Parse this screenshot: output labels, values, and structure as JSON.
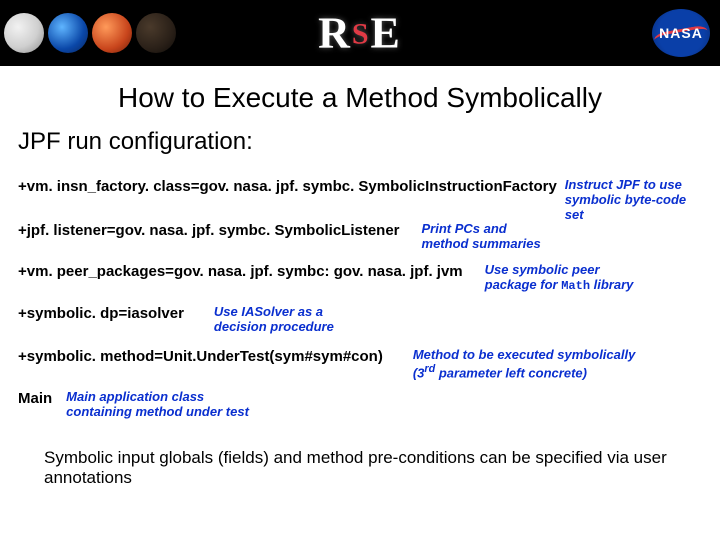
{
  "header": {
    "logo_r": "R",
    "logo_s": "S",
    "logo_e": "E",
    "nasa": "NASA"
  },
  "title": "How to Execute a Method Symbolically",
  "subtitle": "JPF run configuration:",
  "lines": {
    "l1": {
      "cfg": "+vm. insn_factory. class=gov. nasa. jpf. symbc. SymbolicInstructionFactory",
      "note1": "Instruct JPF to use",
      "note2": "symbolic byte-code set"
    },
    "l2": {
      "cfg": "+jpf. listener=gov. nasa. jpf. symbc. SymbolicListener",
      "note1": "Print PCs and",
      "note2": "method summaries"
    },
    "l3": {
      "cfg": "+vm. peer_packages=gov. nasa. jpf. symbc: gov. nasa. jpf. jvm",
      "note1": "Use symbolic peer",
      "note2a": "package for ",
      "note2mono": "Math",
      "note2b": " library"
    },
    "l4": {
      "cfg": "+symbolic. dp=iasolver",
      "note1": "Use IASolver as a",
      "note2": "decision procedure"
    },
    "l5": {
      "cfg": "+symbolic. method=Unit.UnderTest(sym#sym#con)",
      "note1": "Method to be executed symbolically",
      "note2a": "(3",
      "note2sup": "rd",
      "note2b": " parameter left concrete)"
    },
    "l6": {
      "kw": "Main",
      "note1": "Main application class",
      "note2": "containing method under test"
    }
  },
  "footer": "Symbolic input globals (fields) and method pre-conditions can be specified via user annotations"
}
